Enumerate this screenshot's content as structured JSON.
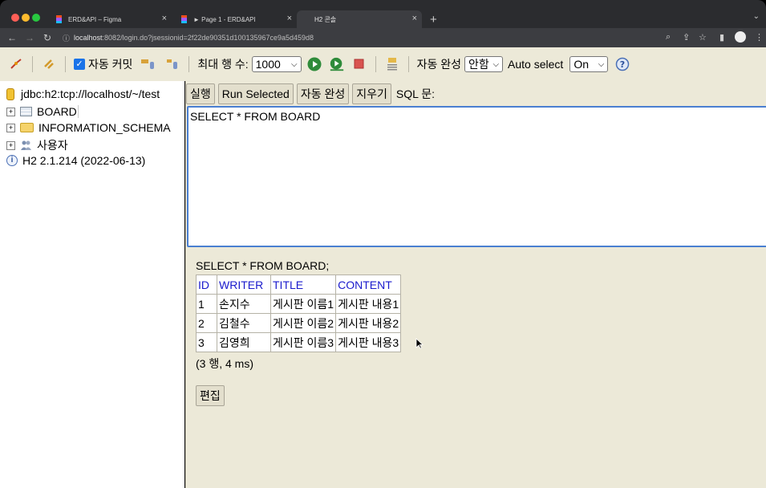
{
  "browser": {
    "tabs": [
      {
        "title": "ERD&API – Figma"
      },
      {
        "title": "► Page 1 - ERD&API"
      },
      {
        "title": "H2 콘솔"
      }
    ],
    "url_host": "localhost",
    "url_rest": ":8082/login.do?jsessionid=2f22de90351d100135967ce9a5d459d8"
  },
  "toolbar": {
    "auto_commit_label": "자동 커밋",
    "max_rows_label": "최대 행 수:",
    "max_rows_value": "1000",
    "auto_complete_label": "자동 완성",
    "auto_complete_value": "안함",
    "auto_select_label": "Auto select",
    "auto_select_value": "On"
  },
  "tree": {
    "connection": "jdbc:h2:tcp://localhost/~/test",
    "items": [
      "BOARD",
      "INFORMATION_SCHEMA",
      "사용자"
    ],
    "version": "H2 2.1.214 (2022-06-13)"
  },
  "editor": {
    "buttons": [
      "실행",
      "Run Selected",
      "자동 완성",
      "지우기"
    ],
    "sql_label": "SQL 문:",
    "query": "SELECT * FROM BOARD"
  },
  "result": {
    "statement": "SELECT * FROM BOARD;",
    "columns": [
      "ID",
      "WRITER",
      "TITLE",
      "CONTENT"
    ],
    "rows": [
      [
        "1",
        "손지수",
        "게시판 이름1",
        "게시판 내용1"
      ],
      [
        "2",
        "김철수",
        "게시판 이름2",
        "게시판 내용2"
      ],
      [
        "3",
        "김영희",
        "게시판 이름3",
        "게시판 내용3"
      ]
    ],
    "summary": "(3 행, 4 ms)",
    "edit_label": "편집"
  }
}
